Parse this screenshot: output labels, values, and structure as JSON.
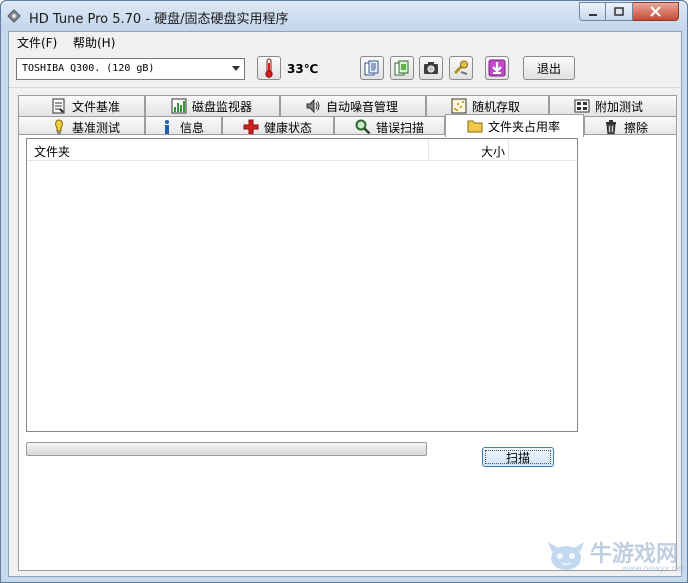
{
  "window": {
    "title": "HD Tune Pro 5.70 - 硬盘/固态硬盘实用程序"
  },
  "menu": {
    "items": [
      {
        "label": "文件(F)"
      },
      {
        "label": "帮助(H)"
      }
    ]
  },
  "toolbar": {
    "drive": "TOSHIBA Q300. (120 gB)",
    "temperature": "33℃",
    "exit_label": "退出",
    "icons": [
      "copy-text-icon",
      "copy-screen-icon",
      "camera-icon",
      "options-icon",
      "download-icon"
    ]
  },
  "tabs": {
    "row_top": [
      {
        "label": "文件基准",
        "icon": "file-benchmark-icon"
      },
      {
        "label": "磁盘监视器",
        "icon": "disk-monitor-icon"
      },
      {
        "label": "自动噪音管理",
        "icon": "speaker-icon"
      },
      {
        "label": "随机存取",
        "icon": "random-access-icon"
      },
      {
        "label": "附加测试",
        "icon": "extra-tests-icon"
      }
    ],
    "row_bottom": [
      {
        "label": "基准测试",
        "icon": "benchmark-icon"
      },
      {
        "label": "信息",
        "icon": "info-icon"
      },
      {
        "label": "健康状态",
        "icon": "health-icon"
      },
      {
        "label": "错误扫描",
        "icon": "error-scan-icon"
      },
      {
        "label": "文件夹占用率",
        "icon": "folder-icon",
        "active": true
      },
      {
        "label": "擦除",
        "icon": "trash-icon"
      }
    ]
  },
  "folder_usage": {
    "columns": [
      "文件夹",
      "大小"
    ],
    "rows": [],
    "progress": 0,
    "scan_label": "扫描"
  },
  "watermark": {
    "text": "牛游戏网",
    "sub": "www.newyx.net"
  },
  "colors": {
    "title_bar": "#c9d9ec",
    "close_button": "#c74a36",
    "scan_button_border": "#3c7fb1"
  }
}
